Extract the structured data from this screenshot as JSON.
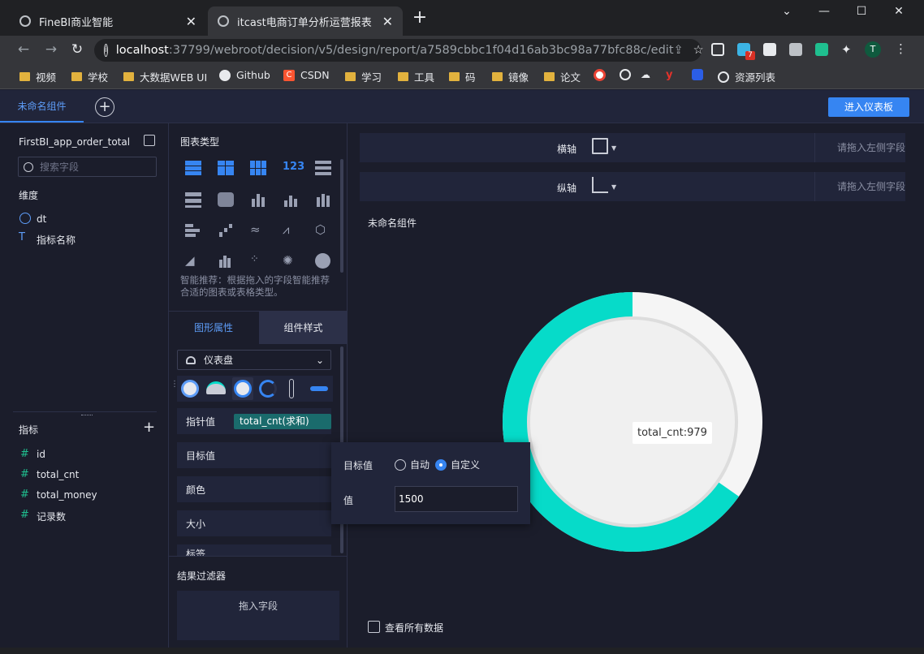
{
  "browser": {
    "tabs": [
      {
        "title": "FineBI商业智能",
        "active": false
      },
      {
        "title": "itcast电商订单分析运营报表",
        "active": true
      }
    ],
    "url_host": "localhost",
    "url_path": ":37799/webroot/decision/v5/design/report/a7589cbbc1f04d16ab3bc98a77bfc88c/edit",
    "ext_badge": "7",
    "profile_initial": "T",
    "bookmarks": [
      "视频",
      "学校",
      "大数据WEB UI",
      "Github",
      "CSDN",
      "学习",
      "工具",
      "码",
      "镜像",
      "论文",
      "资源列表"
    ]
  },
  "header": {
    "component_tab": "未命名组件",
    "enter_dashboard": "进入仪表板"
  },
  "left": {
    "dataset_name": "FirstBI_app_order_total",
    "search_placeholder": "搜索字段",
    "dimension_title": "维度",
    "dimensions": [
      "dt",
      "指标名称"
    ],
    "metric_title": "指标",
    "metrics": [
      "id",
      "total_cnt",
      "total_money",
      "记录数"
    ]
  },
  "middle": {
    "chart_type_title": "图表类型",
    "smart_tip": "智能推荐：根据拖入的字段智能推荐合适的图表或表格类型。",
    "tab_graph": "图形属性",
    "tab_style": "组件样式",
    "gauge_select": "仪表盘",
    "pointer_label": "指针值",
    "pointer_field": "total_cnt(求和)",
    "target_label": "目标值",
    "color_label": "颜色",
    "size_label": "大小",
    "label_label": "标签",
    "filter_title": "结果过滤器",
    "drop_field": "拖入字段"
  },
  "right": {
    "x_axis": "横轴",
    "y_axis": "纵轴",
    "drop_hint": "请拖入左侧字段",
    "component_title": "未命名组件",
    "view_all": "查看所有数据",
    "tooltip": "total_cnt:979"
  },
  "popup": {
    "target_label": "目标值",
    "auto": "自动",
    "custom": "自定义",
    "value_label": "值",
    "value": "1500"
  },
  "chart_data": {
    "type": "gauge",
    "field": "total_cnt",
    "value": 979,
    "target": 1500,
    "fill_color": "#06dbc9",
    "track_color": "#f5f5f5"
  }
}
